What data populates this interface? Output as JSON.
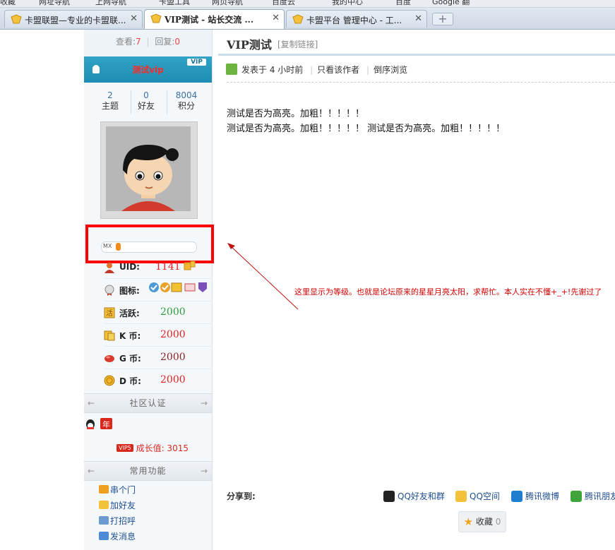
{
  "browser": {
    "bookmarks": [
      "收藏",
      "网址导航",
      "上网导航",
      "卡盟工具",
      "网页导航",
      "百度云",
      "我的中心",
      "百度",
      "Google 翻"
    ],
    "tabs": [
      {
        "title": "卡盟联盟—专业的卡盟联..."
      },
      {
        "title": "VIP测试 - 站长交流 ..."
      },
      {
        "title": "卡盟平台 管理中心 - 工..."
      }
    ],
    "close_glyph": "✕",
    "new_tab_glyph": "+"
  },
  "sidebar": {
    "views_label": "查看:",
    "views": "7",
    "sep": "|",
    "replies_label": "回复:",
    "replies": "0",
    "username": "测试vip",
    "vip_badge": "VIP",
    "stats": [
      {
        "value": "2",
        "label": "主题"
      },
      {
        "value": "0",
        "label": "好友"
      },
      {
        "value": "8004",
        "label": "积分"
      }
    ],
    "level_tag": "MX",
    "level_progress": 0.06,
    "rows": [
      {
        "label": "UID:",
        "value": "1141",
        "color": "#e02020"
      },
      {
        "label": "图标:",
        "value": "",
        "color": "#333333"
      },
      {
        "label": "活跃:",
        "value": "2000",
        "color": "#2e9a3c"
      },
      {
        "label": "K 币:",
        "value": "2000",
        "color": "#e02020"
      },
      {
        "label": "G 币:",
        "value": "2000",
        "color": "#8a2020"
      },
      {
        "label": "D 币:",
        "value": "2000",
        "color": "#e02020"
      }
    ],
    "cert_header": "社区认证",
    "growth_badge": "VIP5",
    "growth_label": "成长值: 3015",
    "func_header": "常用功能",
    "functions": [
      "串个门",
      "加好友",
      "打招呼",
      "发消息"
    ],
    "arrow_left": "←",
    "arrow_right": "→"
  },
  "post": {
    "title": "VIP测试",
    "copy_link": "[复制链接]",
    "posted_prefix": "发表于",
    "posted_time": "4 小时前",
    "meta_sep": "|",
    "author_only": "只看该作者",
    "reverse": "倒序浏览",
    "line1": "测试是否为高亮。加粗！！！！！",
    "line2": "测试是否为高亮。加粗！！！！！  测试是否为高亮。加粗！！！！！"
  },
  "annotation": {
    "text": "这里显示为等级。也就是论坛原来的星星月亮太阳，求帮忙。本人实在不懂+_+!先谢过了",
    "color": "#d40000"
  },
  "share": {
    "label": "分享到:",
    "items": [
      "QQ好友和群",
      "QQ空间",
      "腾讯微博",
      "腾讯朋友"
    ],
    "favorite_label": "收藏",
    "favorite_count": "0"
  }
}
